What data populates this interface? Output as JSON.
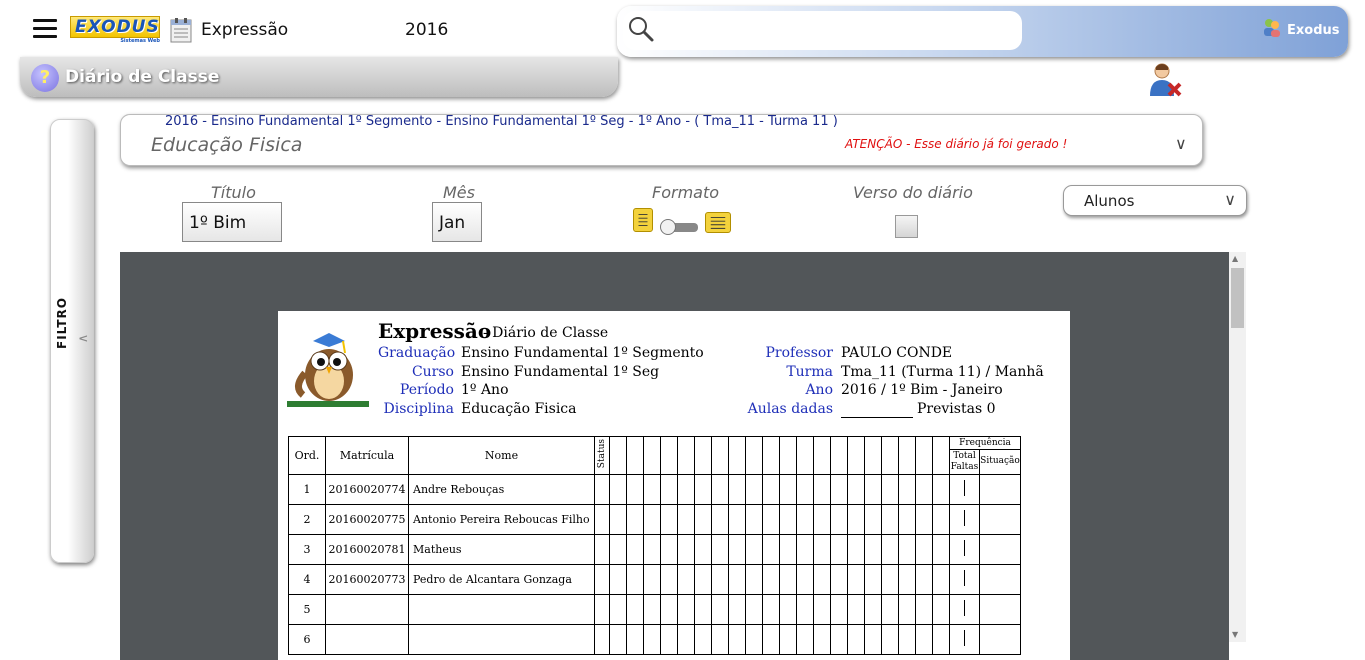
{
  "header": {
    "logo_text": "EXODUS",
    "logo_subtext": "Sistemas Web",
    "app_name": "Expressão",
    "year": "2016",
    "search_placeholder": "",
    "user_label": "Exodus"
  },
  "page": {
    "title": "Diário de Classe"
  },
  "filter": {
    "label": "FILTRO"
  },
  "class_info": {
    "line": "2016 - Ensino Fundamental 1º Segmento - Ensino Fundamental 1º Seg - 1º Ano - ( Tma_11 - Turma 11 )",
    "subject": "Educação Fisica",
    "warning": "ATENÇÃO - Esse diário já foi gerado !"
  },
  "controls": {
    "titulo_label": "Título",
    "titulo_value": "1º Bim",
    "mes_label": "Mês",
    "mes_value": "Jan",
    "formato_label": "Formato",
    "verso_label": "Verso do diário",
    "alunos_value": "Alunos"
  },
  "report": {
    "title": "Expressão",
    "subtitle": "- Diário de Classe",
    "left_fields": [
      {
        "label": "Graduação",
        "value": "Ensino Fundamental 1º Segmento"
      },
      {
        "label": "Curso",
        "value": "Ensino Fundamental 1º Seg"
      },
      {
        "label": "Período",
        "value": "1º Ano"
      },
      {
        "label": "Disciplina",
        "value": "Educação Fisica"
      }
    ],
    "right_fields": [
      {
        "label": "Professor",
        "value": "PAULO CONDE"
      },
      {
        "label": "Turma",
        "value": "Tma_11 (Turma 11) / Manhã"
      },
      {
        "label": "Ano",
        "value": "2016 / 1º Bim - Janeiro"
      },
      {
        "label": "Aulas dadas",
        "value": "Previstas 0"
      }
    ],
    "table": {
      "col_ord": "Ord.",
      "col_matricula": "Matrícula",
      "col_nome": "Nome",
      "col_status": "Status",
      "col_frequencia": "Frequência",
      "col_total_faltas": "Total Faltas",
      "col_situacao": "Situação",
      "rows": [
        {
          "ord": "1",
          "matricula": "20160020774",
          "nome": "Andre Rebouças"
        },
        {
          "ord": "2",
          "matricula": "20160020775",
          "nome": "Antonio Pereira Reboucas Filho"
        },
        {
          "ord": "3",
          "matricula": "20160020781",
          "nome": "Matheus"
        },
        {
          "ord": "4",
          "matricula": "20160020773",
          "nome": "Pedro de Alcantara Gonzaga"
        },
        {
          "ord": "5",
          "matricula": "",
          "nome": ""
        },
        {
          "ord": "6",
          "matricula": "",
          "nome": ""
        }
      ]
    }
  }
}
